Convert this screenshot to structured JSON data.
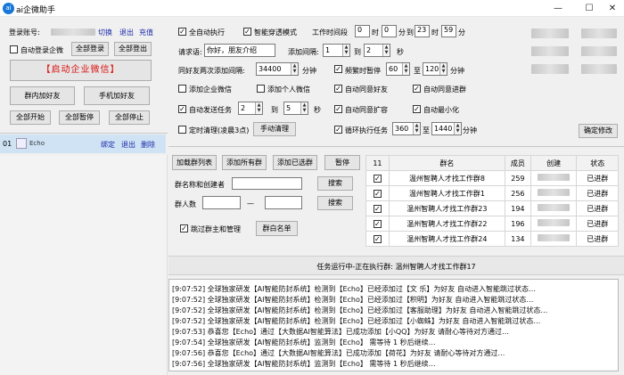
{
  "window": {
    "title": "ai企微助手",
    "app_icon_text": "ai",
    "min_label": "—",
    "max_label": "☐",
    "close_label": "✕"
  },
  "account": {
    "label": "登录账号:",
    "switch": "切换",
    "logout": "退出",
    "recharge": "充值"
  },
  "left": {
    "auto_login_label": "自动登录企微",
    "login_all": "全部登录",
    "logout_all": "全部登出",
    "start_wecom": "【启动企业微信】",
    "group_add": "群内加好友",
    "phone_add": "手机加好友",
    "start_all": "全部开始",
    "pause_all": "全部暂停",
    "stop_all": "全部停止",
    "acct_row": {
      "index": "01",
      "name": "Echo",
      "unbind": "绑定",
      "exit": "退出",
      "delete": "删除"
    }
  },
  "settings": {
    "full_auto": "全自动执行",
    "smart_mode": "智能穿透模式",
    "work_time_label": "工作时间段",
    "t_start_h": "0",
    "t_h1": "时",
    "t_start_m": "0",
    "t_m1": "分",
    "t_to": "到",
    "t_end_h": "23",
    "t_h2": "时",
    "t_end_m": "59",
    "t_m2": "分",
    "request_label": "请求语:",
    "request_value": "你好，朋友介绍",
    "interval_label": "添加间隔:",
    "interval_from": "1",
    "to1": "到",
    "interval_to": "2",
    "sec1": "秒",
    "same_friend_label": "同好友两次添加间隔:",
    "same_friend_value": "34400",
    "min1": "分钟",
    "frequent_pause": "频繁时暂停",
    "fp_from": "60",
    "to2": "至",
    "fp_to": "120",
    "min2": "分钟",
    "add_wecom": "添加企业微信",
    "add_personal": "添加个人微信",
    "auto_agree": "自动同意好友",
    "auto_join": "自动同意进群",
    "auto_send": "自动发送任务",
    "as_from": "2",
    "to3": "到",
    "as_to": "5",
    "sec2": "秒",
    "auto_expand": "自动同意扩容",
    "auto_min": "自动最小化",
    "timed_clean": "定时清理(凌晨3点)",
    "manual_clean": "手动清理",
    "loop_task": "循环执行任务",
    "loop_from": "360",
    "to4": "至",
    "loop_to": "1440",
    "min3": "分钟",
    "confirm": "确定修改"
  },
  "groups": {
    "load_list": "加载群列表",
    "add_all": "添加所有群",
    "add_selected": "添加已选群",
    "pause": "暂停",
    "name_creator_label": "群名称和创建者",
    "search1": "搜索",
    "count_label": "群人数",
    "dash": "—",
    "search2": "搜索",
    "skip_owner": "跳过群主和管理",
    "whitelist": "群白名单",
    "columns": [
      "11",
      "群名",
      "成员",
      "创建",
      "状态"
    ],
    "rows": [
      {
        "name": "温州智聘人才找工作群8",
        "members": "259",
        "status": "已进群"
      },
      {
        "name": "温州智聘人才找工作群1",
        "members": "256",
        "status": "已进群"
      },
      {
        "name": "温州智聘人才找工作群23",
        "members": "194",
        "status": "已进群"
      },
      {
        "name": "温州智聘人才找工作群22",
        "members": "196",
        "status": "已进群"
      },
      {
        "name": "温州智聘人才找工作群24",
        "members": "134",
        "status": "已进群"
      }
    ]
  },
  "status_bar": "任务运行中-正在执行群: 温州智聘人才找工作群17",
  "log": [
    "[9:07:52] 全球独家研发【AI智能防封系统】检测到【Echo】已经添加过【文 乐】为好友 自动进入智能跳过状态…",
    "[9:07:52] 全球独家研发【AI智能防封系统】检测到【Echo】已经添加过【积明】为好友 自动进入智能跳过状态…",
    "[9:07:52] 全球独家研发【AI智能防封系统】检测到【Echo】已经添加过【客服助理】为好友 自动进入智能跳过状态…",
    "[9:07:52] 全球独家研发【AI智能防封系统】检测到【Echo】已经添加过【小蜘蛛】为好友 自动进入智能跳过状态…",
    "[9:07:53] 恭喜您【Echo】通过【大数据AI智能算法】已成功添加【小QQ】为好友 请耐心等待对方通过…",
    "[9:07:54] 全球独家研发【AI智能防封系统】监测到【Echo】 需等待 1 秒后继续…",
    "[9:07:56] 恭喜您【Echo】通过【大数据AI智能算法】已成功添加【荷花】为好友 请耐心等待对方通过…",
    "[9:07:56] 全球独家研发【AI智能防封系统】监测到【Echo】 需等待 1 秒后继续…"
  ]
}
